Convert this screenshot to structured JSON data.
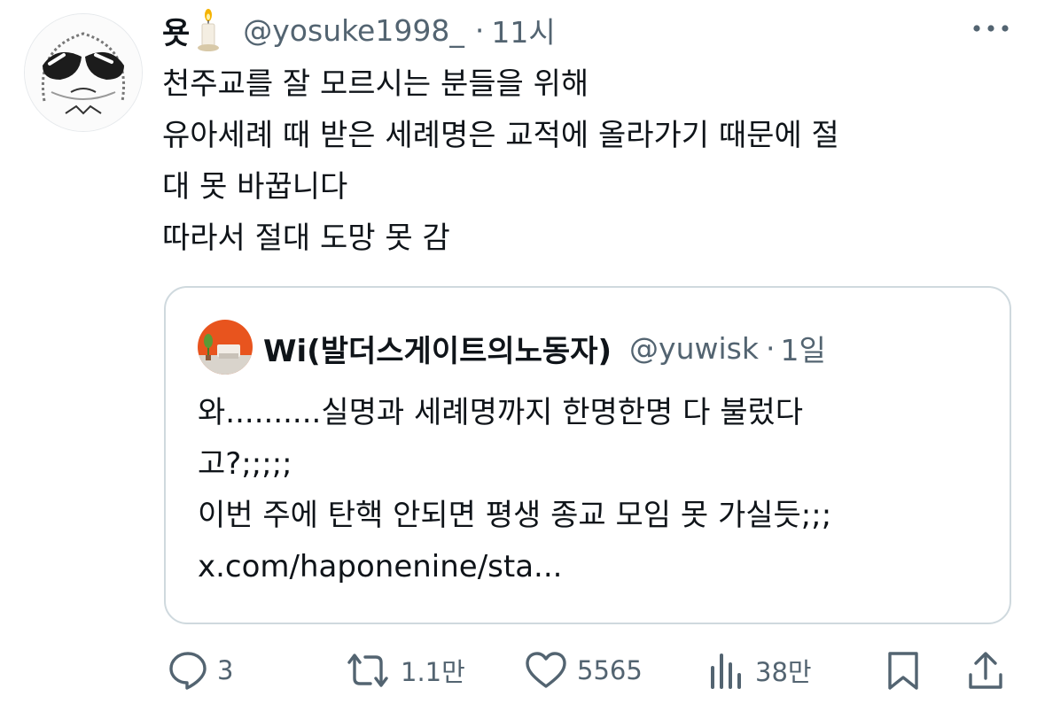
{
  "tweet": {
    "name": "욧",
    "handle": "@yosuke1998_",
    "separator": "·",
    "time": "11시",
    "lines": [
      "천주교를 잘 모르시는 분들을 위해",
      "유아세례 때 받은 세례명은 교적에 올라가기 때문에 절",
      "대 못 바꿉니다",
      "따라서 절대 도망 못 감"
    ],
    "icons": {
      "avatar": "avatar-image",
      "name_badge": "candle-icon",
      "more": "more-icon"
    }
  },
  "quote": {
    "name": "Wi(발더스게이트의노동자)",
    "handle": "@yuwisk",
    "separator": "·",
    "time": "1일",
    "lines": [
      "와..........실명과 세례명까지 한명한명 다 불렀다",
      "고?;;;;;",
      "이번 주에 탄핵 안되면 평생 종교 모임 못 가실듯;;;",
      "x.com/haponenine/sta..."
    ]
  },
  "actions": {
    "reply": {
      "icon": "reply-icon",
      "count": "3"
    },
    "repost": {
      "icon": "repost-icon",
      "count": "1.1만"
    },
    "like": {
      "icon": "heart-icon",
      "count": "5565"
    },
    "views": {
      "icon": "views-icon",
      "count": "38만"
    },
    "bookmark": {
      "icon": "bookmark-icon"
    },
    "share": {
      "icon": "share-icon"
    }
  },
  "colors": {
    "text": "#0f1419",
    "secondary": "#536471",
    "border": "#cfd9de",
    "quote_avatar_bg": "#e8541e"
  }
}
